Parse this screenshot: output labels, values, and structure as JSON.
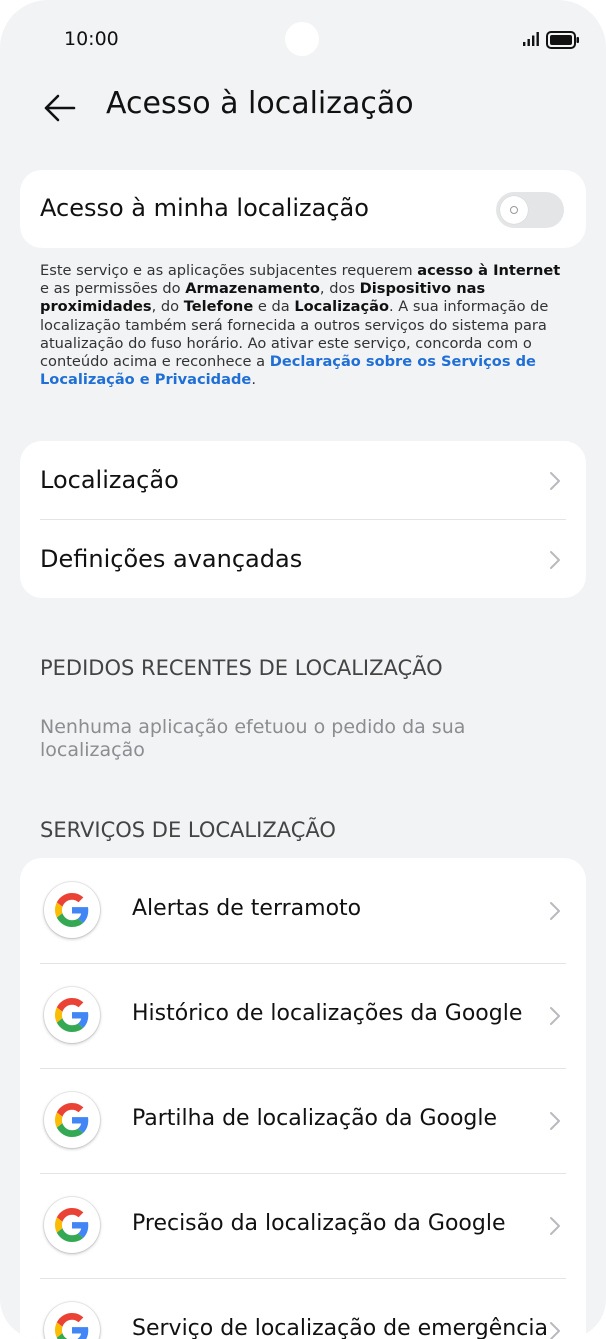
{
  "status_bar": {
    "time": "10:00",
    "icons": [
      "signal-icon",
      "battery-icon"
    ]
  },
  "header": {
    "title": "Acesso à localização",
    "back_icon": "arrow-left-icon"
  },
  "location_access": {
    "label": "Acesso à minha localização",
    "toggle_on": false
  },
  "description": {
    "p1": "Este serviço e as aplicações subjacentes requerem ",
    "b1": "acesso à Internet",
    "p2": " e as permissões do ",
    "b2": "Armazenamento",
    "p3": ", dos ",
    "b3": "Dispositivo nas proximidades",
    "p4": ", do ",
    "b4": "Telefone",
    "p5": " e da ",
    "b5": "Localização",
    "p6": ". A sua informação de localização também será fornecida a outros serviços do sistema para atualização do fuso horário. Ao ativar este serviço, concorda com o conteúdo acima e reconhece a ",
    "link": "Declaração sobre os Serviços de Localização e Privacidade",
    "p7": "."
  },
  "menu": {
    "items": [
      {
        "label": "Localização"
      },
      {
        "label": "Definições avançadas"
      }
    ]
  },
  "recent_requests": {
    "header": "PEDIDOS RECENTES DE LOCALIZAÇÃO",
    "empty_text": "Nenhuma aplicação efetuou o pedido da sua localização"
  },
  "location_services": {
    "header": "SERVIÇOS DE LOCALIZAÇÃO",
    "items": [
      {
        "label": "Alertas de terramoto",
        "icon": "google-logo-icon"
      },
      {
        "label": "Histórico de localizações da Google",
        "icon": "google-logo-icon"
      },
      {
        "label": "Partilha de localização da Google",
        "icon": "google-logo-icon"
      },
      {
        "label": "Precisão da localização da Google",
        "icon": "google-logo-icon"
      },
      {
        "label": "Serviço de localização de emergência",
        "icon": "google-logo-icon"
      }
    ]
  },
  "colors": {
    "background": "#f1f3f5",
    "card": "#ffffff",
    "link": "#1f6fd6",
    "secondary_text": "#8b8d90",
    "toggle_off": "#e4e5e7"
  }
}
